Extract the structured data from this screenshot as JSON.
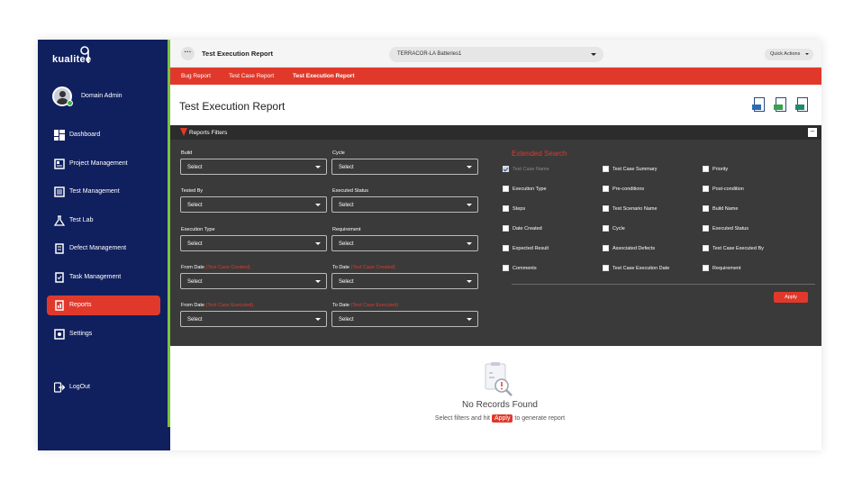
{
  "app": {
    "logo_text": "kualitee"
  },
  "user": {
    "name": "Domain Admin"
  },
  "sidebar": {
    "items": [
      {
        "label": "Dashboard",
        "icon": "dashboard-icon"
      },
      {
        "label": "Project Management",
        "icon": "project-icon"
      },
      {
        "label": "Test Management",
        "icon": "test-management-icon"
      },
      {
        "label": "Test Lab",
        "icon": "flask-icon"
      },
      {
        "label": "Defect Management",
        "icon": "defect-icon"
      },
      {
        "label": "Task Management",
        "icon": "task-icon"
      },
      {
        "label": "Reports",
        "icon": "reports-icon",
        "active": true
      },
      {
        "label": "Settings",
        "icon": "settings-icon"
      }
    ],
    "logout": "LogOut"
  },
  "header": {
    "title": "Test Execution Report",
    "project": "TERRACOR-LA Batteries1",
    "quick_actions": "Quick Actions"
  },
  "tabs": [
    "Bug Report",
    "Test Case Report",
    "Test Execution Report"
  ],
  "page": {
    "title": "Test Execution Report"
  },
  "filters": {
    "title": "Reports Filters",
    "fields": [
      {
        "label": "Build",
        "value": "Select"
      },
      {
        "label": "Cycle",
        "value": "Select"
      },
      {
        "label": "Tested By",
        "value": "Select"
      },
      {
        "label": "Executed Status",
        "value": "Select"
      },
      {
        "label": "Execution Type",
        "value": "Select"
      },
      {
        "label": "Requirement",
        "value": "Select"
      },
      {
        "label": "From Date",
        "hint": "(Test Case Created)",
        "value": "Select"
      },
      {
        "label": "To Date",
        "hint": "(Test Case Created)",
        "value": "Select"
      },
      {
        "label": "From Date",
        "hint": "(Test Case Executed)",
        "value": "Select"
      },
      {
        "label": "To Date",
        "hint": "(Test Case Executed)",
        "value": "Select"
      }
    ]
  },
  "extended_search": {
    "title": "Extended Search",
    "options": [
      {
        "label": "Test Case Name",
        "checked": true
      },
      {
        "label": "Test Case Summary",
        "checked": false
      },
      {
        "label": "Priority",
        "checked": false
      },
      {
        "label": "Execution Type",
        "checked": false
      },
      {
        "label": "Pre-conditions",
        "checked": false
      },
      {
        "label": "Post-condition",
        "checked": false
      },
      {
        "label": "Steps",
        "checked": false
      },
      {
        "label": "Test Scenario Name",
        "checked": false
      },
      {
        "label": "Build Name",
        "checked": false
      },
      {
        "label": "Date Created",
        "checked": false
      },
      {
        "label": "Cycle",
        "checked": false
      },
      {
        "label": "Executed Status",
        "checked": false
      },
      {
        "label": "Expected Result",
        "checked": false
      },
      {
        "label": "Associated Defects",
        "checked": false
      },
      {
        "label": "Test Case Executed By",
        "checked": false
      },
      {
        "label": "Comments",
        "checked": false
      },
      {
        "label": "Test Case Execution Date",
        "checked": false
      },
      {
        "label": "Requirement",
        "checked": false
      }
    ],
    "apply": "Apply"
  },
  "empty_state": {
    "title": "No Records Found",
    "sub_before": "Select filters and hit",
    "sub_apply": "Apply",
    "sub_after": "to generate report"
  },
  "colors": {
    "accent": "#e0392b",
    "sidebar": "#10205e",
    "green": "#7cc242",
    "panel": "#3a3a3a"
  }
}
